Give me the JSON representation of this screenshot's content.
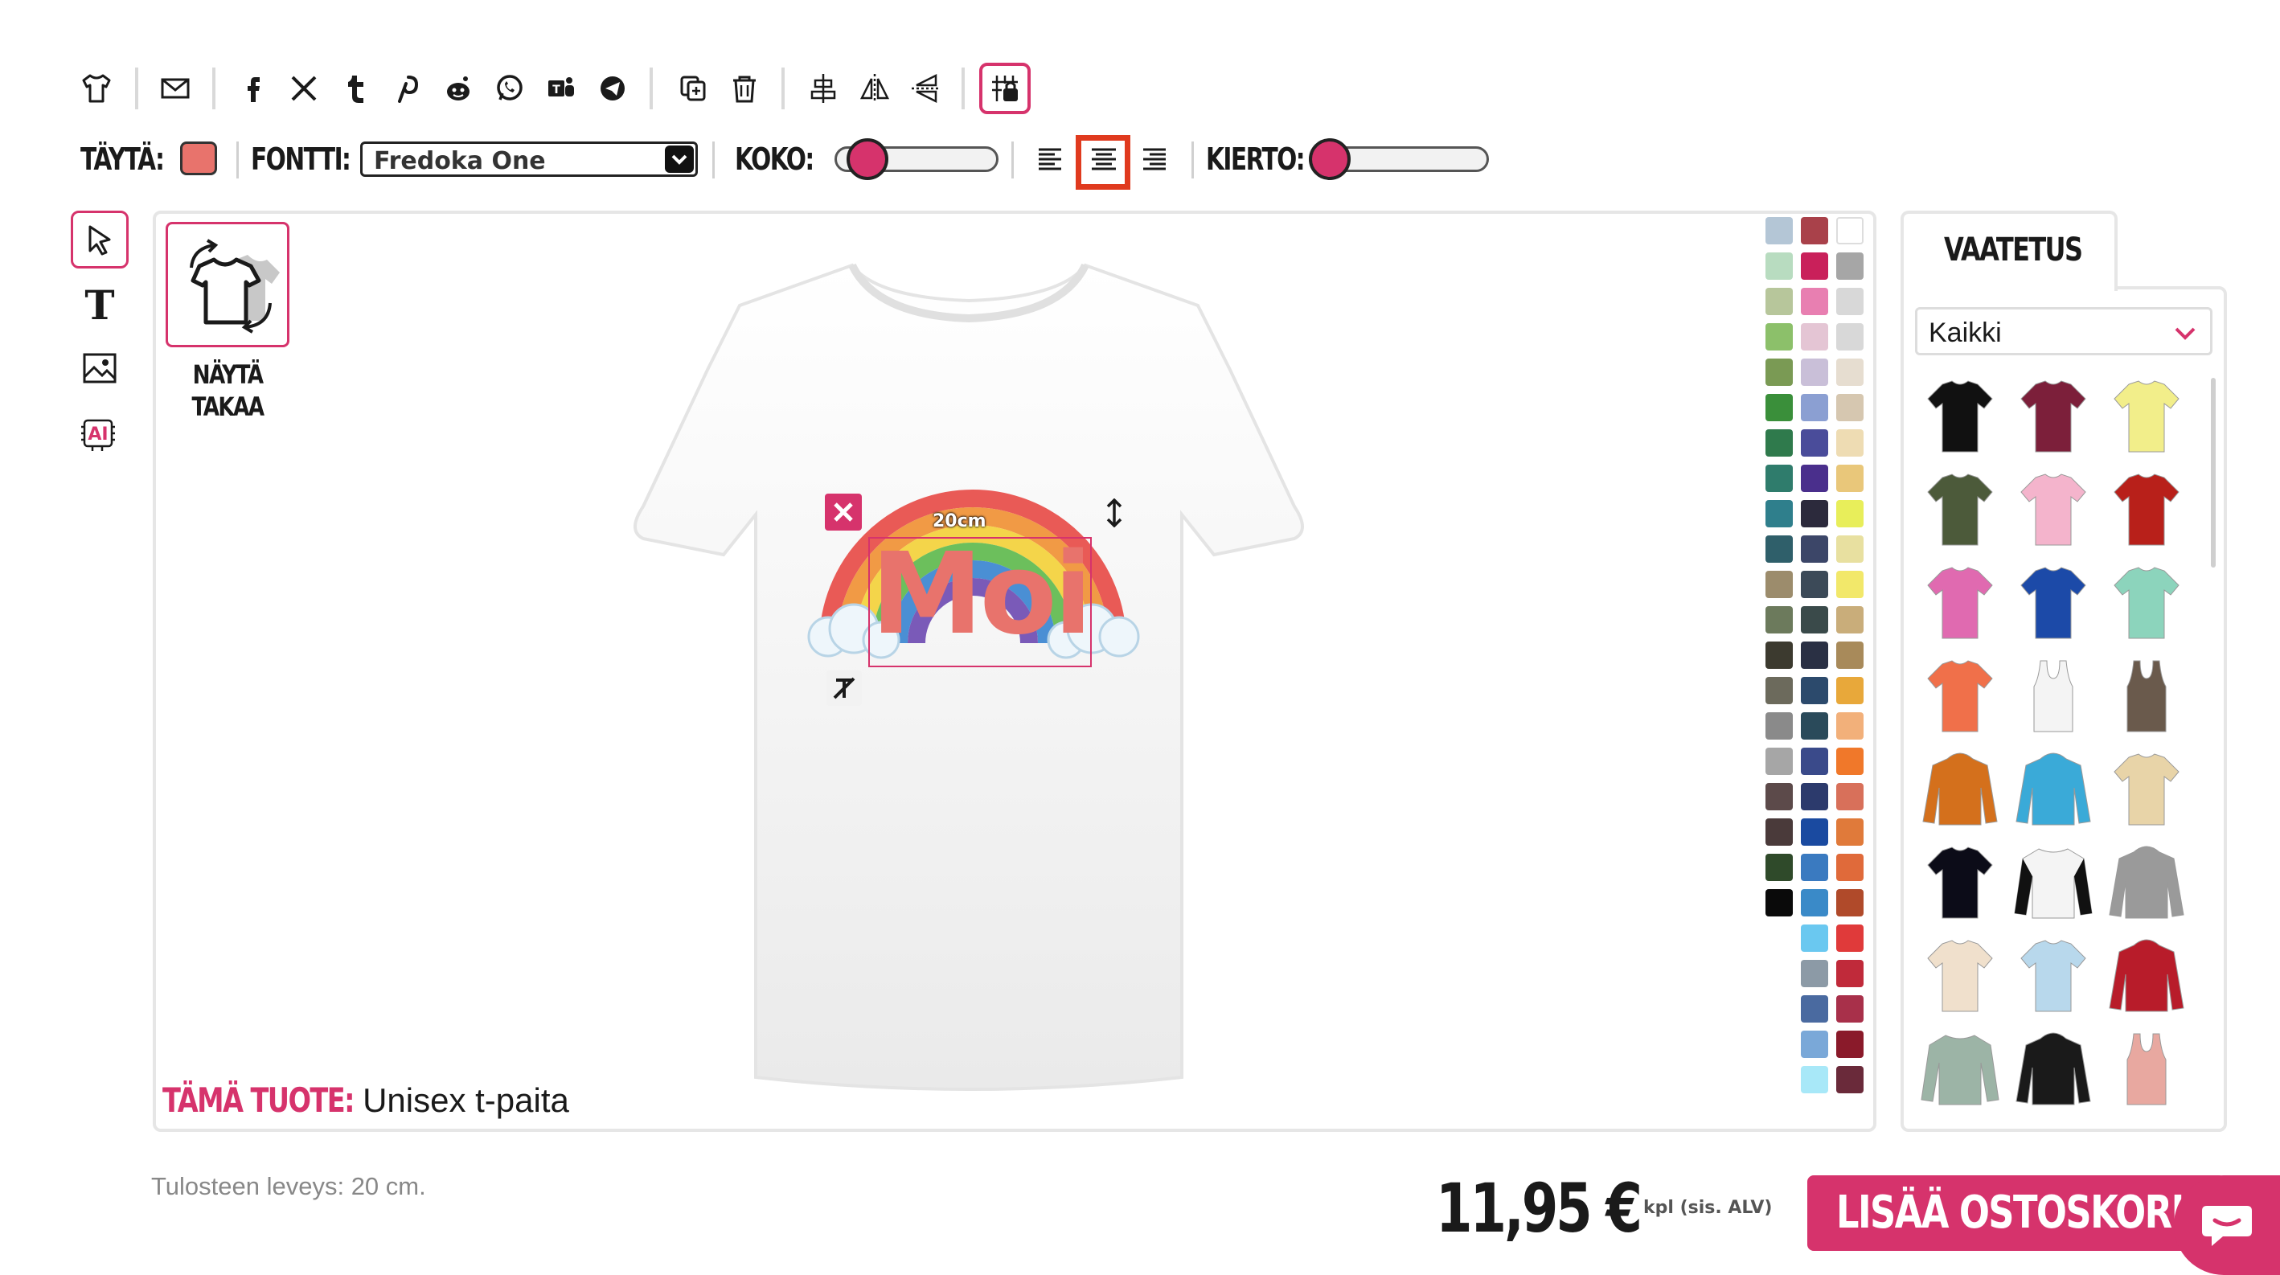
{
  "toolbar": {
    "icons": [
      "tshirt-icon",
      "email-icon",
      "facebook-icon",
      "x-icon",
      "tumblr-icon",
      "pinterest-icon",
      "reddit-icon",
      "whatsapp-icon",
      "teams-icon",
      "telegram-icon",
      "duplicate-icon",
      "trash-icon",
      "align-center-vertical-icon",
      "flip-horizontal-icon",
      "flip-vertical-icon",
      "grid-lock-icon"
    ],
    "fill_label": "TÄYTÄ:",
    "fill_color": "#e8736c",
    "font_label": "FONTTI:",
    "font_value": "Fredoka One",
    "size_label": "KOKO:",
    "size_value": 0.1,
    "rotation_label": "KIERTO:",
    "rotation_value": 0.0,
    "alignment_selected": "center"
  },
  "tools": [
    "select-tool",
    "text-tool",
    "image-tool",
    "ai-tool"
  ],
  "flip": {
    "label_line1": "NÄYTÄ",
    "label_line2": "TAKAA"
  },
  "design": {
    "text": "Moi",
    "text_color": "#e8736c",
    "width_badge": "20cm"
  },
  "product": {
    "label": "TÄMÄ TUOTE:",
    "value": "Unisex t-paita"
  },
  "palette_colors": [
    [
      "#b4c6d6",
      "#a9414a",
      "#ffffff"
    ],
    [
      "#b8dcc0",
      "#c9205a",
      "#a6a6a6"
    ],
    [
      "#b7c69b",
      "#e87fb1",
      "#d8d8d8"
    ],
    [
      "#8cc06a",
      "#e4c5d4",
      "#d8d8d8"
    ],
    [
      "#7a9a54",
      "#c9bfd8",
      "#e6ddd0"
    ],
    [
      "#3a8f3a",
      "#8b9fd2",
      "#d6c7b0"
    ],
    [
      "#2f7a4c",
      "#4a4c9a",
      "#eedcb3"
    ],
    [
      "#2f7c6c",
      "#4a2f8c",
      "#e9c77a"
    ],
    [
      "#2f7f8c",
      "#2c2a3c",
      "#e8ee5a"
    ],
    [
      "#2f5f6a",
      "#3c4668",
      "#e8e0a0"
    ],
    [
      "#9c8c6c",
      "#3c4a58",
      "#f2e86a"
    ],
    [
      "#6c7a5c",
      "#3a4a4a",
      "#c9ad7a"
    ],
    [
      "#3c3a2f",
      "#2a3044",
      "#a88a5a"
    ],
    [
      "#6c6a5c",
      "#2c4a6c",
      "#e8a83a"
    ],
    [
      "#8a8a8a",
      "#2a4a5a",
      "#f2b07a"
    ],
    [
      "#a6a6a6",
      "#3a4a8a",
      "#f0782a"
    ],
    [
      "#5c4a4a",
      "#2c3a6c",
      "#d8705a"
    ],
    [
      "#4a3a3a",
      "#1a4aa0",
      "#e07a3a"
    ],
    [
      "#2f4a2a",
      "#3a7ac0",
      "#e06a3a"
    ],
    [
      "#0a0a0a",
      "#3a8ac8",
      "#b04a2a"
    ],
    [
      "",
      "#6ac8f0",
      "#e03a3a"
    ],
    [
      "",
      "#8c9aa6",
      "#c02a3a"
    ],
    [
      "",
      "#4a6aa0",
      "#a8304a"
    ],
    [
      "",
      "#7aa8d8",
      "#8a1a2a"
    ],
    [
      "",
      "#a8e8f8",
      "#6a2a3a"
    ]
  ],
  "clothing": {
    "tab_label": "VAATETUS",
    "filter_value": "Kaikki",
    "items": [
      {
        "name": "tshirt-black",
        "color": "#111111",
        "kind": "tee"
      },
      {
        "name": "tshirt-burgundy",
        "color": "#7c1f3a",
        "kind": "tee"
      },
      {
        "name": "tshirt-yellow",
        "color": "#f2ee8a",
        "kind": "tee"
      },
      {
        "name": "tshirt-olive",
        "color": "#4c5a3a",
        "kind": "tee"
      },
      {
        "name": "tshirt-pink",
        "color": "#f4b4cc",
        "kind": "tee"
      },
      {
        "name": "tshirt-red",
        "color": "#b8201a",
        "kind": "tee"
      },
      {
        "name": "tshirt-women-fuchsia",
        "color": "#e06ab0",
        "kind": "tee"
      },
      {
        "name": "tshirt-royal-blue",
        "color": "#1c4aa8",
        "kind": "tee"
      },
      {
        "name": "tshirt-mint",
        "color": "#8cd4bc",
        "kind": "tee"
      },
      {
        "name": "tshirt-women-coral",
        "color": "#f0704a",
        "kind": "tee"
      },
      {
        "name": "tank-white",
        "color": "#f4f4f4",
        "kind": "tank"
      },
      {
        "name": "tank-brown",
        "color": "#6a5a4c",
        "kind": "tank"
      },
      {
        "name": "hoodie-orange",
        "color": "#d4701c",
        "kind": "hoodie"
      },
      {
        "name": "hoodie-sky",
        "color": "#3aaad8",
        "kind": "hoodie"
      },
      {
        "name": "tshirt-tiedye",
        "color": "#e8d4a8",
        "kind": "tee"
      },
      {
        "name": "tshirt-black-2",
        "color": "#0c0c18",
        "kind": "tee"
      },
      {
        "name": "raglan-white-black",
        "color": "#f4f4f4",
        "kind": "raglan"
      },
      {
        "name": "hoodie-grey",
        "color": "#9a9a9a",
        "kind": "hoodie"
      },
      {
        "name": "tshirt-cream",
        "color": "#f0e0cc",
        "kind": "tee"
      },
      {
        "name": "tshirt-dip-blue",
        "color": "#b8d8ec",
        "kind": "tee"
      },
      {
        "name": "jacket-red",
        "color": "#b81c2a",
        "kind": "hoodie"
      },
      {
        "name": "longsleeve-sage",
        "color": "#9cb4a6",
        "kind": "raglan"
      },
      {
        "name": "hoodie-black-orange",
        "color": "#1a1a1a",
        "kind": "hoodie"
      },
      {
        "name": "tank-rose",
        "color": "#e8a8a0",
        "kind": "tank"
      }
    ]
  },
  "footer": {
    "print_width_note": "Tulosteen leveys: 20 cm.",
    "price": "11,95 €",
    "price_sub": "kpl (sis. ALV)",
    "cart_label": "LISÄÄ OSTOSKORIIN"
  }
}
